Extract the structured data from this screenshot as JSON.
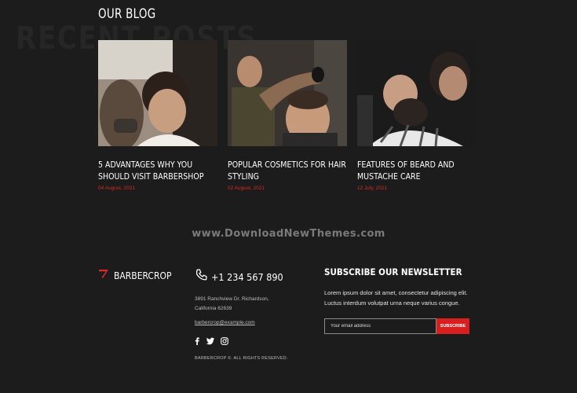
{
  "blog": {
    "title": "OUR BLOG",
    "background_word": "RECENT POSTS",
    "posts": [
      {
        "title": "5 ADVANTAGES WHY YOU SHOULD VISIT BARBERSHOP",
        "date": "04 August, 2021"
      },
      {
        "title": "POPULAR COSMETICS FOR HAIR STYLING",
        "date": "02 August, 2021"
      },
      {
        "title": "FEATURES OF BEARD AND MUSTACHE CARE",
        "date": "12 July, 2021"
      }
    ]
  },
  "watermark": "www.DownloadNewThemes.com",
  "footer": {
    "brand": "BARBERCROP",
    "phone": "+1 234 567 890",
    "address_line1": "3891 Ranchview Dr. Richardson,",
    "address_line2": "California 62639",
    "email": "barbercrop@example.com",
    "social_icons": [
      "facebook-icon",
      "twitter-icon",
      "instagram-icon"
    ],
    "copyright": "BARBERCROP ©. ALL RIGHTS RESERVED.",
    "newsletter": {
      "title": "SUBSCRIBE OUR NEWSLETTER",
      "text": "Lorem ipsum dolor sit amet, consectetur adipiscing elit. Luctus interdum volutpat urna neque varius congue.",
      "input_placeholder": "Your email address",
      "button": "SUBSCRIBE"
    }
  },
  "colors": {
    "background": "#1c1c1c",
    "accent": "#d52b25"
  }
}
